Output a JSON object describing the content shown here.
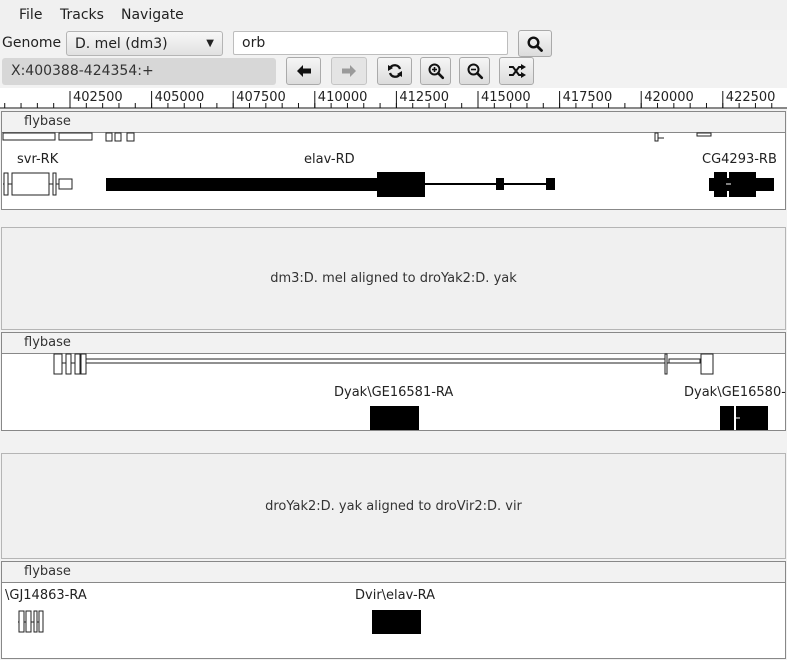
{
  "menu": {
    "file": "File",
    "tracks": "Tracks",
    "navigate": "Navigate"
  },
  "toolbar": {
    "genome_label": "Genome",
    "genome_selected": "D. mel (dm3)",
    "search_value": "orb",
    "locus": "X:400388-424354:+"
  },
  "icons": {
    "search": "search-icon",
    "back": "arrow-left-icon",
    "forward": "arrow-right-icon",
    "refresh": "refresh-icon",
    "zoom_in": "zoom-in-icon",
    "zoom_out": "zoom-out-icon",
    "shuffle": "shuffle-icon"
  },
  "ruler": {
    "ticks": [
      "402500",
      "405000",
      "407500",
      "410000",
      "412500",
      "415000",
      "417500",
      "420000",
      "422500"
    ]
  },
  "tracks": [
    {
      "header": "flybase",
      "genes": [
        "svr-RK",
        "elav-RD",
        "CG4293-RB"
      ]
    },
    {
      "header": "flybase",
      "genes": [
        "Dyak\\GE16581-RA",
        "Dyak\\GE16580-"
      ]
    },
    {
      "header": "flybase",
      "genes": [
        "\\GJ14863-RA",
        "Dvir\\elav-RA"
      ]
    }
  ],
  "alignments": [
    "dm3:D. mel aligned to droYak2:D. yak",
    "droYak2:D. yak aligned to droVir2:D. vir"
  ]
}
